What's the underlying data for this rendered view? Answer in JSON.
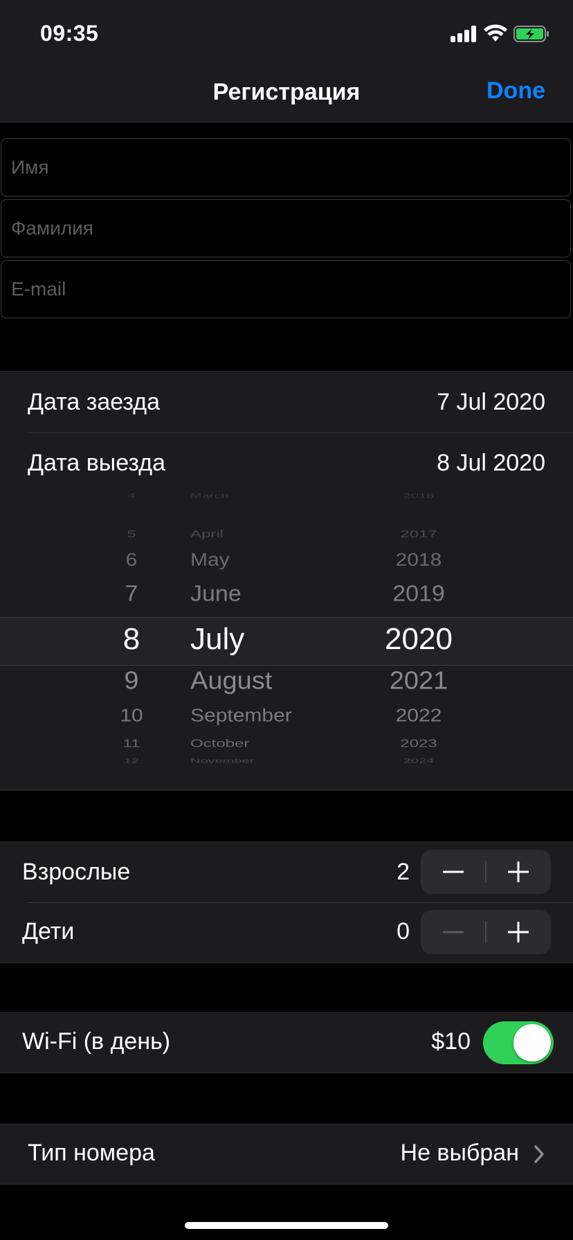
{
  "status_bar": {
    "time": "09:35"
  },
  "nav": {
    "title": "Регистрация",
    "done_label": "Done"
  },
  "form": {
    "first_name_placeholder": "Имя",
    "last_name_placeholder": "Фамилия",
    "email_placeholder": "E-mail"
  },
  "dates": {
    "checkin_label": "Дата заезда",
    "checkin_value": "7 Jul 2020",
    "checkout_label": "Дата выезда",
    "checkout_value": "8 Jul 2020"
  },
  "date_picker": {
    "days": [
      "4",
      "5",
      "6",
      "7",
      "8",
      "9",
      "10",
      "11",
      "12"
    ],
    "months": [
      "March",
      "April",
      "May",
      "June",
      "July",
      "August",
      "September",
      "October",
      "November"
    ],
    "years": [
      "2016",
      "2017",
      "2018",
      "2019",
      "2020",
      "2021",
      "2022",
      "2023",
      "2024"
    ],
    "selected": {
      "day": "8",
      "month": "July",
      "year": "2020"
    }
  },
  "guests": {
    "adults_label": "Взрослые",
    "adults_count": "2",
    "children_label": "Дети",
    "children_count": "0",
    "minus_symbol": "−",
    "plus_symbol": "+"
  },
  "wifi": {
    "label": "Wi-Fi (в день)",
    "price": "$10",
    "enabled": true
  },
  "room_type": {
    "label": "Тип номера",
    "value": "Не выбран"
  },
  "colors": {
    "accent": "#0a84ff",
    "toggle_on": "#30d158",
    "battery_charging": "#30d158",
    "background": "#000000",
    "cell": "#1c1c1e"
  }
}
